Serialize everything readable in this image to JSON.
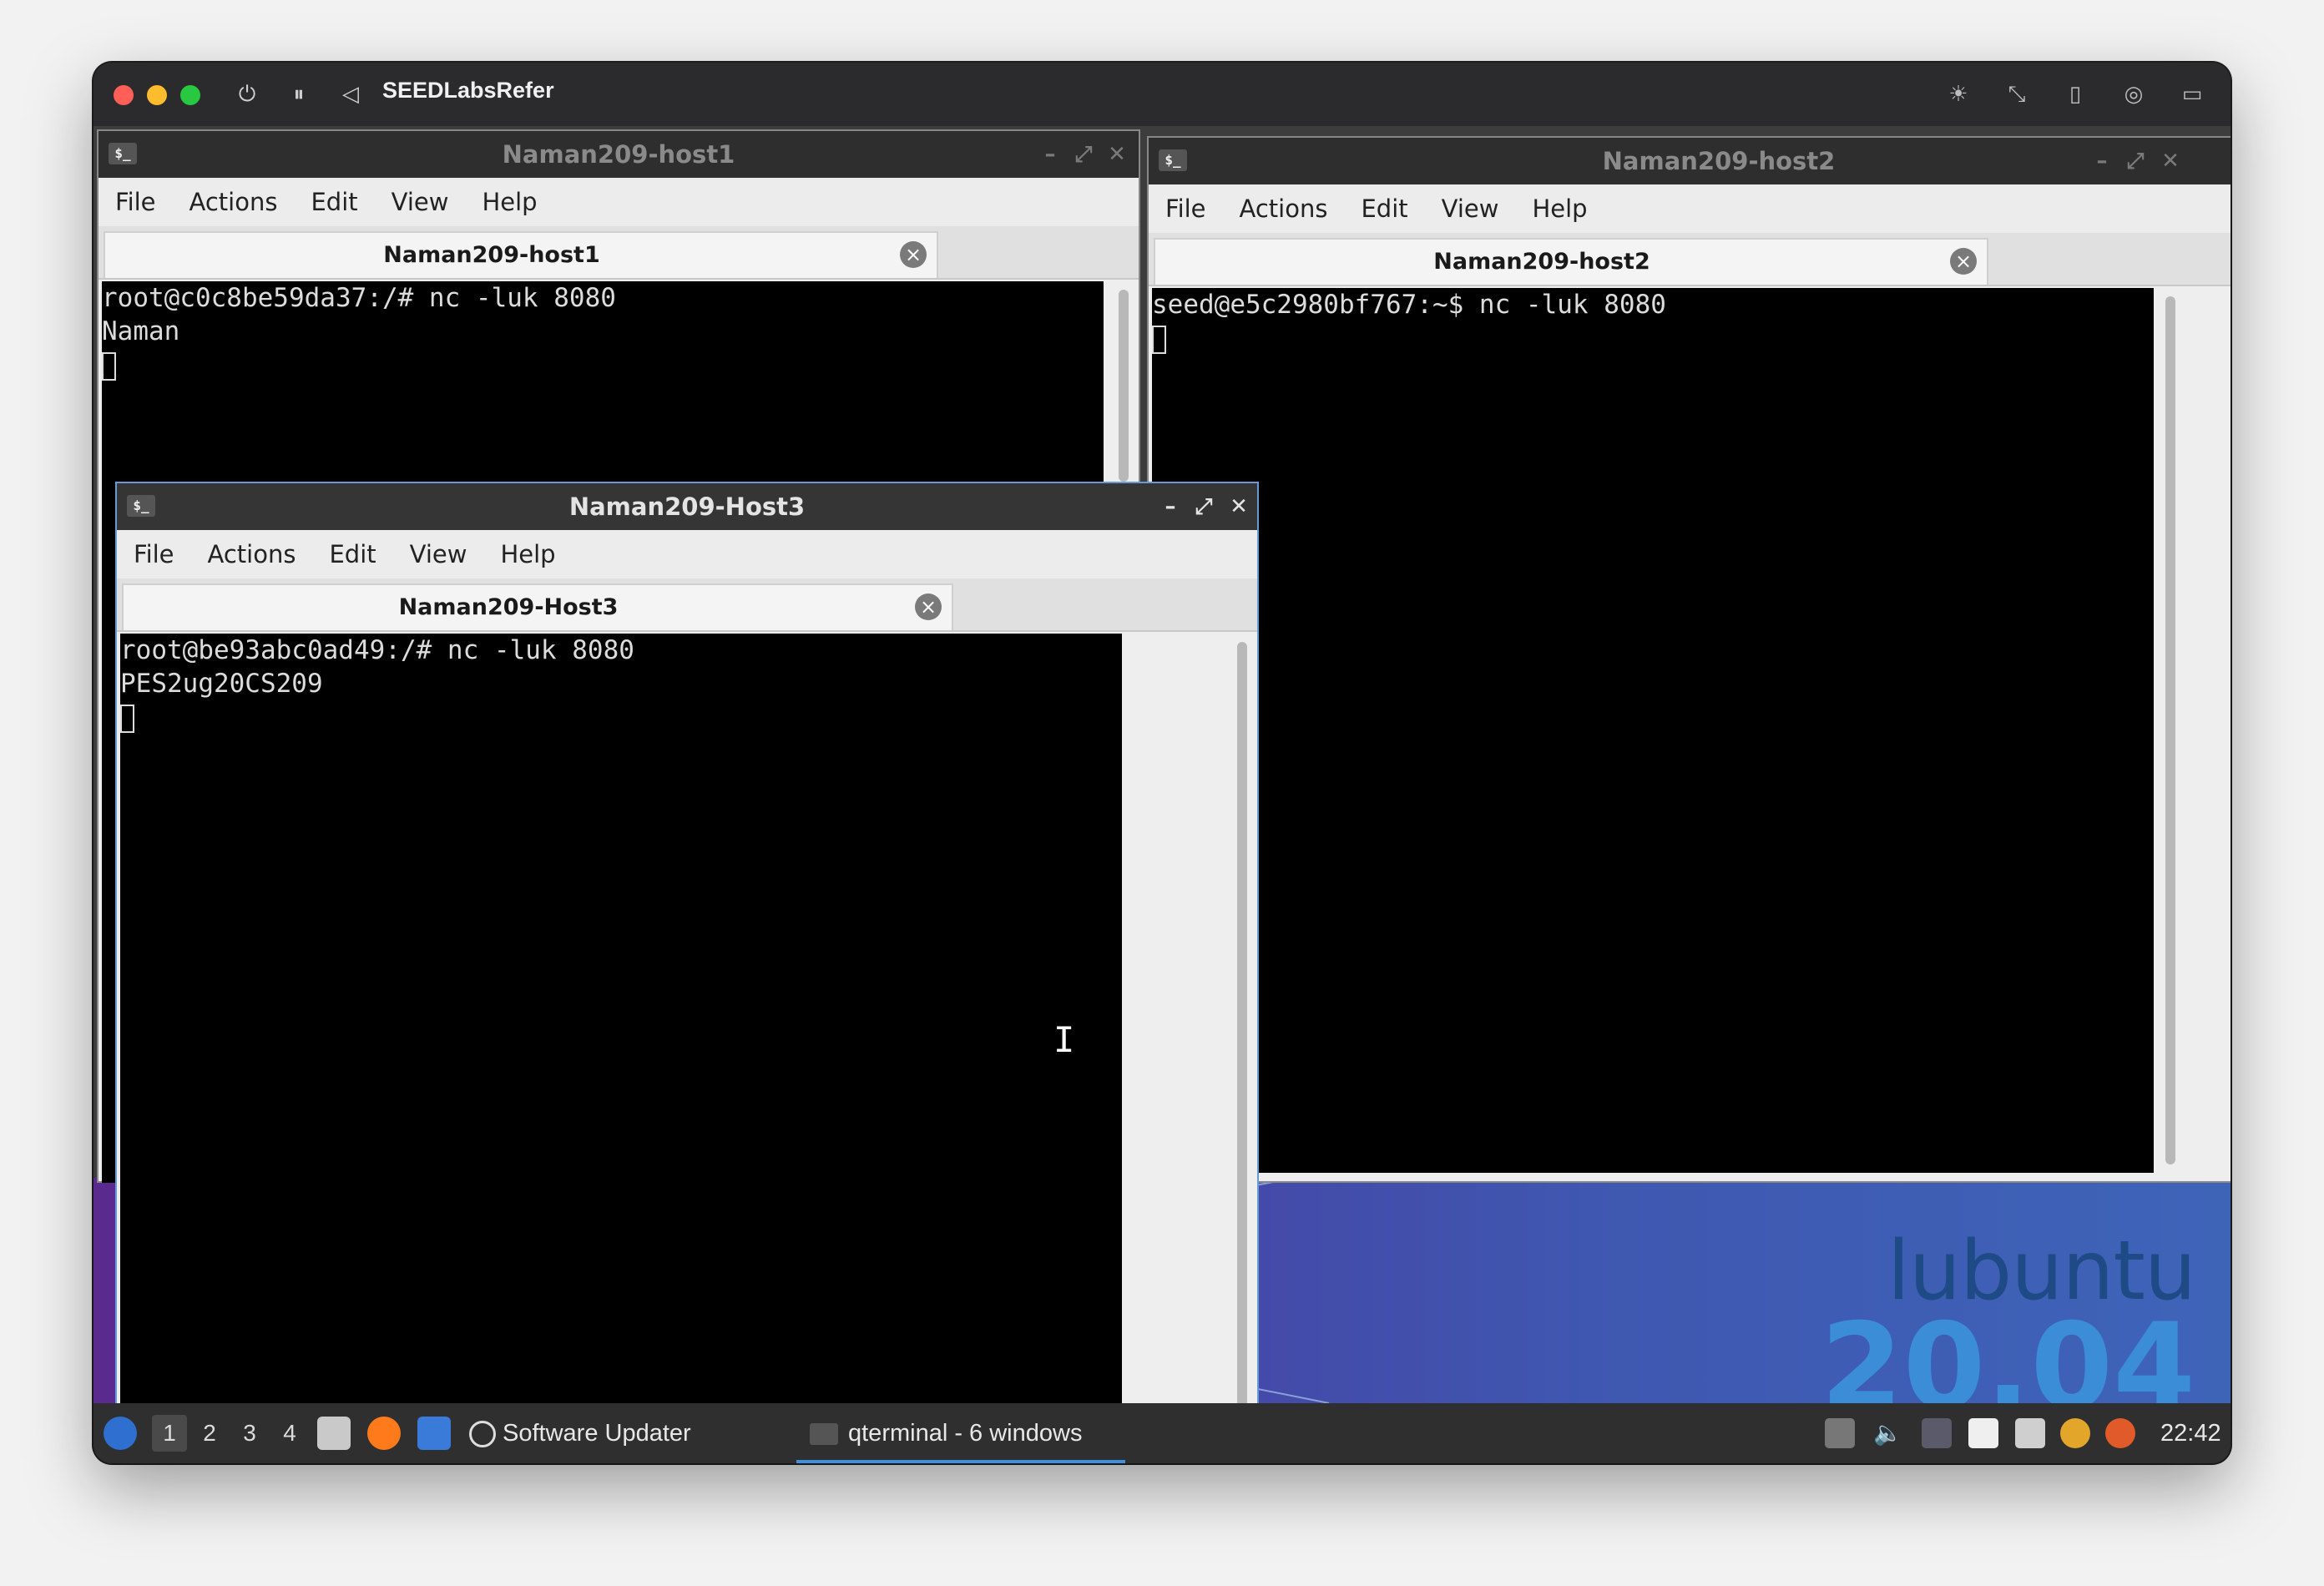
{
  "vm": {
    "title": "SEEDLabsRefer",
    "traffic_colors": {
      "close": "#ff5f57",
      "minimize": "#febc2e",
      "zoom": "#28c840"
    }
  },
  "windows": {
    "host1": {
      "title": "Naman209-host1",
      "menu": [
        "File",
        "Actions",
        "Edit",
        "View",
        "Help"
      ],
      "tab": "Naman209-host1",
      "lines": [
        "root@c0c8be59da37:/# nc -luk 8080",
        "Naman"
      ]
    },
    "host2": {
      "title": "Naman209-host2",
      "menu": [
        "File",
        "Actions",
        "Edit",
        "View",
        "Help"
      ],
      "tab": "Naman209-host2",
      "lines": [
        "seed@e5c2980bf767:~$ nc -luk 8080"
      ]
    },
    "host3": {
      "title": "Naman209-Host3",
      "menu": [
        "File",
        "Actions",
        "Edit",
        "View",
        "Help"
      ],
      "tab": "Naman209-Host3",
      "lines": [
        "root@be93abc0ad49:/# nc -luk 8080",
        "PES2ug20CS209"
      ]
    }
  },
  "wallpaper": {
    "brand": "lubuntu",
    "version": "20.04"
  },
  "taskbar": {
    "workspaces": [
      "1",
      "2",
      "3",
      "4"
    ],
    "active_workspace": "1",
    "software_updater": "Software Updater",
    "task": "qterminal - 6 windows",
    "clock": "22:42"
  },
  "colors": {
    "focus_border": "#6a9ad6",
    "task_underline": "#3d8fe0"
  }
}
